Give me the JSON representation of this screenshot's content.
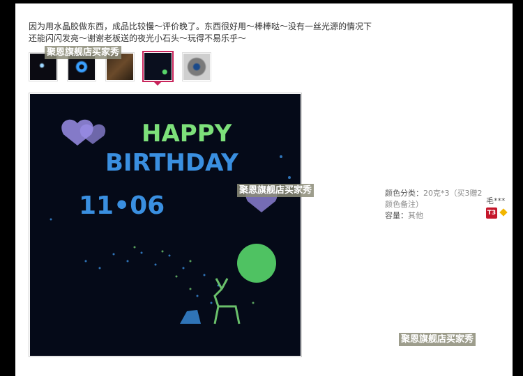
{
  "review": {
    "line1": "因为用水晶胶做东西，成品比较慢～评价晚了。东西很好用～棒棒哒～没有一丝光源的情况下",
    "line2": "还能闪闪发亮～谢谢老板送的夜光小石头～玩得不易乐乎～"
  },
  "watermark": "聚恩旗舰店买家秀",
  "thumbnails": [
    {
      "label": "dark-dot-photo",
      "selected": false
    },
    {
      "label": "blue-ring-photo",
      "selected": false
    },
    {
      "label": "birthday-card-photo",
      "selected": false
    },
    {
      "label": "happy-birthday-glow-photo",
      "selected": true
    },
    {
      "label": "stone-ring-photo",
      "selected": false
    }
  ],
  "photo": {
    "line1": "HAPPY",
    "line2": "BIRTHDAY",
    "date": "11•06",
    "colors": {
      "green": "#7de07a",
      "blue": "#3a8fe0",
      "purple": "#9b8ee8",
      "moon": "#58d66a",
      "bg": "#050a18"
    }
  },
  "sku": {
    "color_label": "颜色分类：",
    "color_value": "20克*3（买3赠2颜色备注）",
    "capacity_label": "容量：",
    "capacity_value": "其他"
  },
  "user": {
    "name": "毛***",
    "badge": "T3"
  },
  "accent": "#c8245b"
}
